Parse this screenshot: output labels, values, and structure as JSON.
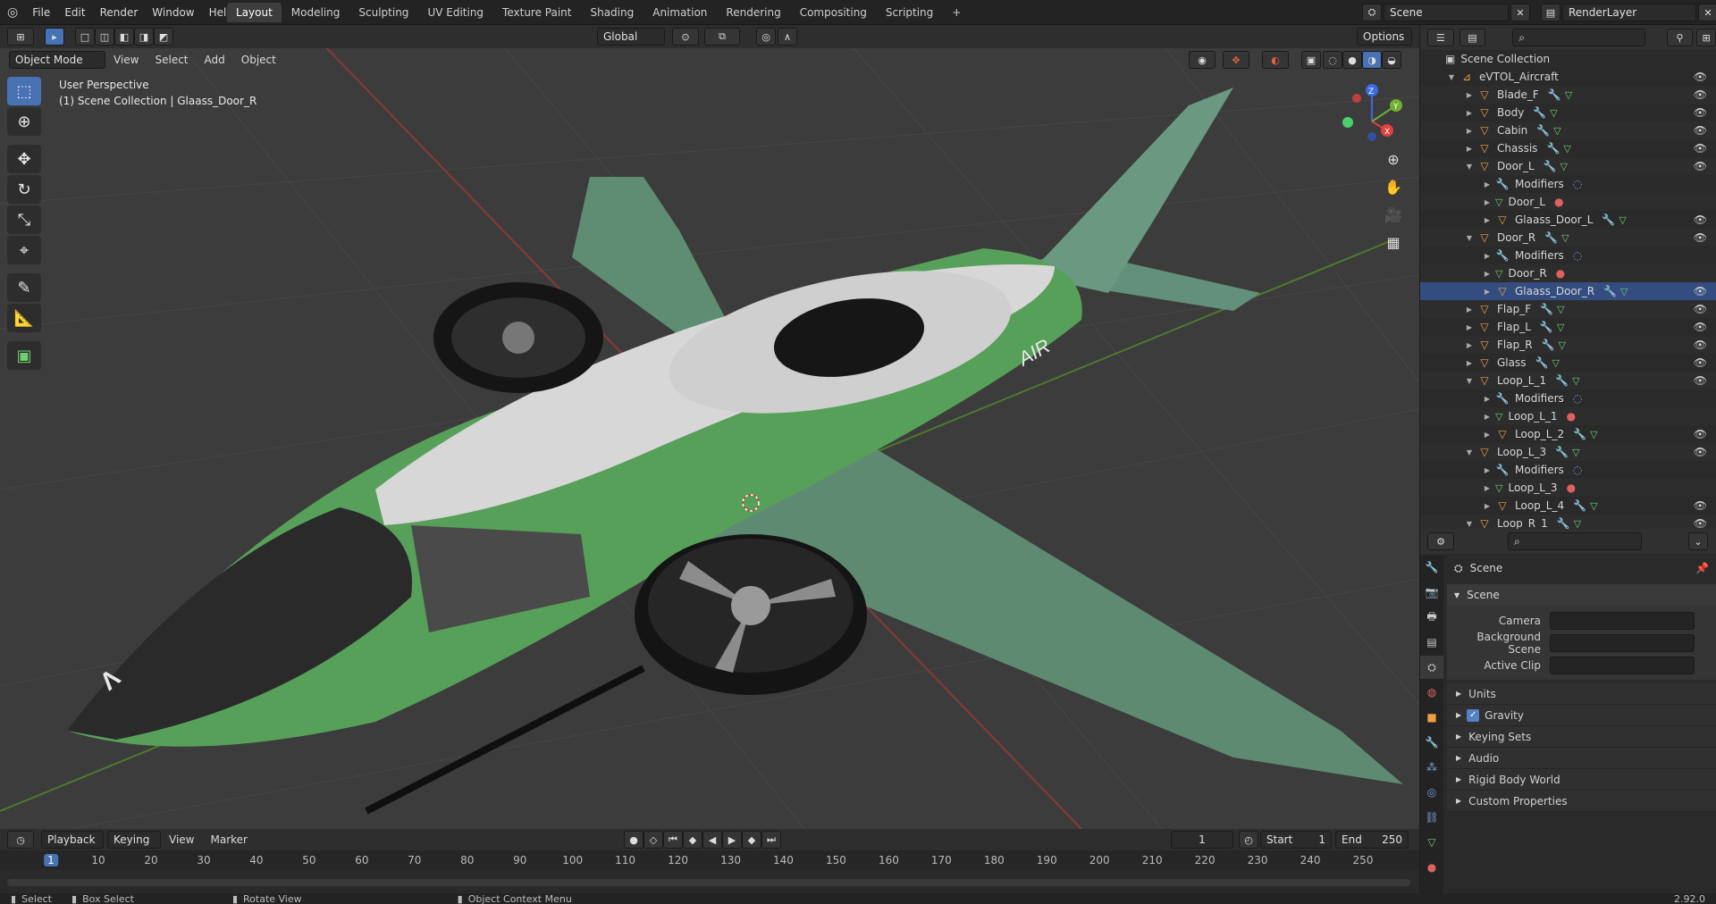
{
  "topbar": {
    "menus": [
      "File",
      "Edit",
      "Render",
      "Window",
      "Help"
    ],
    "workspaces": [
      "Layout",
      "Modeling",
      "Sculpting",
      "UV Editing",
      "Texture Paint",
      "Shading",
      "Animation",
      "Rendering",
      "Compositing",
      "Scripting"
    ],
    "active_workspace": "Layout",
    "add_tab": "+",
    "scene": "Scene",
    "render_layer": "RenderLayer"
  },
  "viewport": {
    "orientation": "Global",
    "options": "Options",
    "mode": "Object Mode",
    "menus": [
      "View",
      "Select",
      "Add",
      "Object"
    ],
    "info_line1": "User Perspective",
    "info_line2": "(1) Scene Collection | Glaass_Door_R",
    "aircraft_logo": "AIR",
    "gizmo": {
      "z": "Z",
      "y": "Y",
      "x": "X"
    }
  },
  "outliner": {
    "root": "Scene Collection",
    "rows": [
      {
        "label": "eVTOL_Aircraft",
        "indent": 1,
        "kind": "collection",
        "open": true
      },
      {
        "label": "Blade_F",
        "indent": 2,
        "kind": "mesh"
      },
      {
        "label": "Body",
        "indent": 2,
        "kind": "mesh"
      },
      {
        "label": "Cabin",
        "indent": 2,
        "kind": "mesh"
      },
      {
        "label": "Chassis",
        "indent": 2,
        "kind": "mesh"
      },
      {
        "label": "Door_L",
        "indent": 2,
        "kind": "mesh",
        "open": true
      },
      {
        "label": "Modifiers",
        "indent": 3,
        "kind": "mod"
      },
      {
        "label": "Door_L",
        "indent": 3,
        "kind": "data"
      },
      {
        "label": "Glaass_Door_L",
        "indent": 3,
        "kind": "mesh"
      },
      {
        "label": "Door_R",
        "indent": 2,
        "kind": "mesh",
        "open": true
      },
      {
        "label": "Modifiers",
        "indent": 3,
        "kind": "mod"
      },
      {
        "label": "Door_R",
        "indent": 3,
        "kind": "data"
      },
      {
        "label": "Glaass_Door_R",
        "indent": 3,
        "kind": "mesh",
        "selected": true
      },
      {
        "label": "Flap_F",
        "indent": 2,
        "kind": "mesh"
      },
      {
        "label": "Flap_L",
        "indent": 2,
        "kind": "mesh"
      },
      {
        "label": "Flap_R",
        "indent": 2,
        "kind": "mesh"
      },
      {
        "label": "Glass",
        "indent": 2,
        "kind": "mesh"
      },
      {
        "label": "Loop_L_1",
        "indent": 2,
        "kind": "mesh",
        "open": true
      },
      {
        "label": "Modifiers",
        "indent": 3,
        "kind": "mod"
      },
      {
        "label": "Loop_L_1",
        "indent": 3,
        "kind": "data"
      },
      {
        "label": "Loop_L_2",
        "indent": 3,
        "kind": "mesh"
      },
      {
        "label": "Loop_L_3",
        "indent": 2,
        "kind": "mesh",
        "open": true
      },
      {
        "label": "Modifiers",
        "indent": 3,
        "kind": "mod"
      },
      {
        "label": "Loop_L_3",
        "indent": 3,
        "kind": "data"
      },
      {
        "label": "Loop_L_4",
        "indent": 3,
        "kind": "mesh"
      },
      {
        "label": "Loop_R_1",
        "indent": 2,
        "kind": "mesh",
        "open": true
      }
    ]
  },
  "properties": {
    "breadcrumb": "Scene",
    "panel": "Scene",
    "fields": [
      {
        "label": "Camera"
      },
      {
        "label": "Background Scene"
      },
      {
        "label": "Active Clip"
      }
    ],
    "subpanels": [
      "Units",
      "Gravity",
      "Keying Sets",
      "Audio",
      "Rigid Body World",
      "Custom Properties"
    ],
    "gravity_checked": true
  },
  "timeline": {
    "menus": [
      "Playback",
      "Keying",
      "View",
      "Marker"
    ],
    "current_frame": "1",
    "start_label": "Start",
    "start": "1",
    "end_label": "End",
    "end": "250",
    "ticks": [
      "1",
      "10",
      "20",
      "30",
      "40",
      "50",
      "60",
      "70",
      "80",
      "90",
      "100",
      "110",
      "120",
      "130",
      "140",
      "150",
      "160",
      "170",
      "180",
      "190",
      "200",
      "210",
      "220",
      "230",
      "240",
      "250"
    ]
  },
  "statusbar": {
    "select": "Select",
    "box_select": "Box Select",
    "rotate_view": "Rotate View",
    "context_menu": "Object Context Menu",
    "version": "2.92.0"
  },
  "colors": {
    "accent": "#4772b3",
    "selected_row": "#334d80",
    "aircraft_green": "#5a8a70",
    "aircraft_white": "#d8d8d8"
  }
}
